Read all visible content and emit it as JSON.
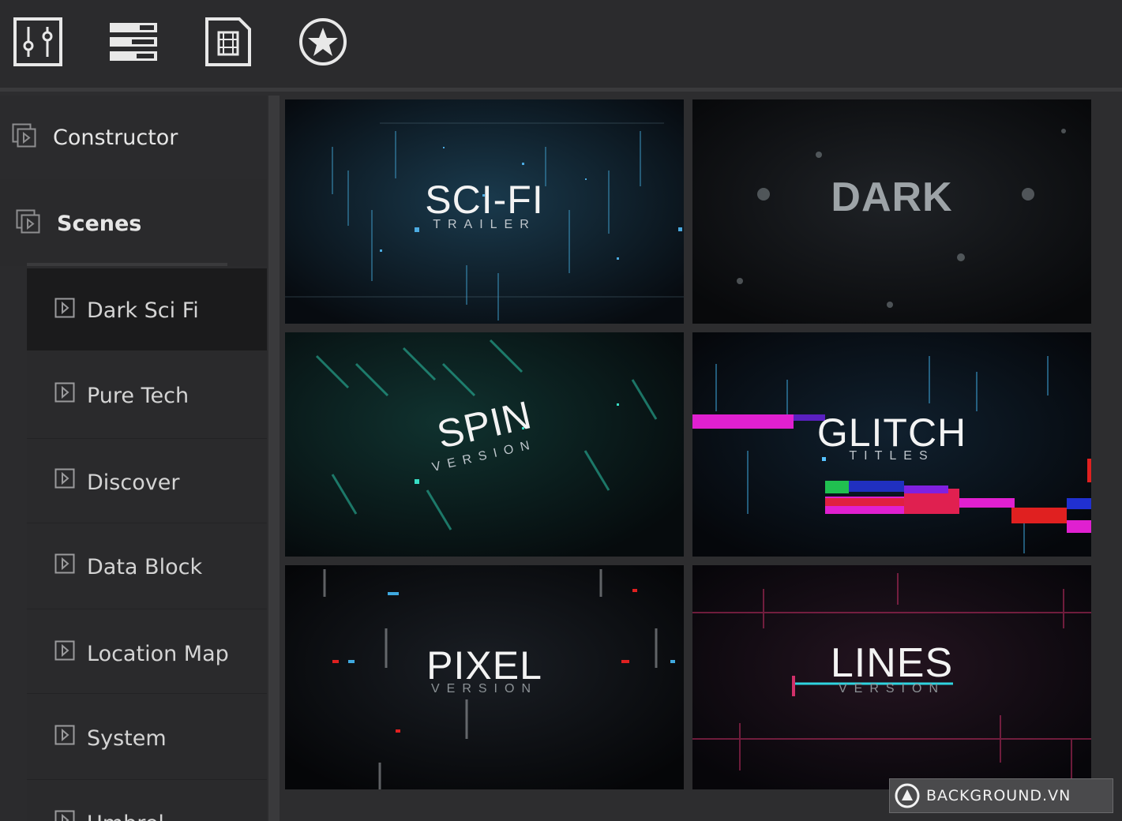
{
  "toolbar": {
    "buttons": [
      {
        "icon": "sliders-icon"
      },
      {
        "icon": "list-icon"
      },
      {
        "icon": "film-icon"
      },
      {
        "icon": "star-icon"
      }
    ]
  },
  "sidebar": {
    "sections": [
      {
        "label": "Constructor",
        "icon": "window-icon"
      },
      {
        "label": "Scenes",
        "icon": "window-icon"
      }
    ],
    "items": [
      {
        "label": "Dark Sci Fi",
        "selected": true
      },
      {
        "label": "Pure Tech"
      },
      {
        "label": "Discover"
      },
      {
        "label": "Data Block"
      },
      {
        "label": "Location Map"
      },
      {
        "label": "System"
      },
      {
        "label": "Umbrel"
      }
    ]
  },
  "grid": {
    "cards": [
      {
        "title": "SCI-FI",
        "subtitle": "TRAILER"
      },
      {
        "title": "DARK",
        "subtitle": ""
      },
      {
        "title": "SPIN",
        "subtitle": "VERSION"
      },
      {
        "title": "GLITCH",
        "subtitle": "TITLES"
      },
      {
        "title": "PIXEL",
        "subtitle": "VERSION"
      },
      {
        "title": "LINES",
        "subtitle": "VERSION"
      }
    ]
  },
  "watermark": {
    "text": "BACKGROUND.VN"
  },
  "colors": {
    "accent_blue": "#3fa9e0",
    "accent_teal": "#2fd4b5",
    "accent_magenta": "#e020d0",
    "accent_red": "#e02040",
    "accent_pink": "#d0306a"
  }
}
